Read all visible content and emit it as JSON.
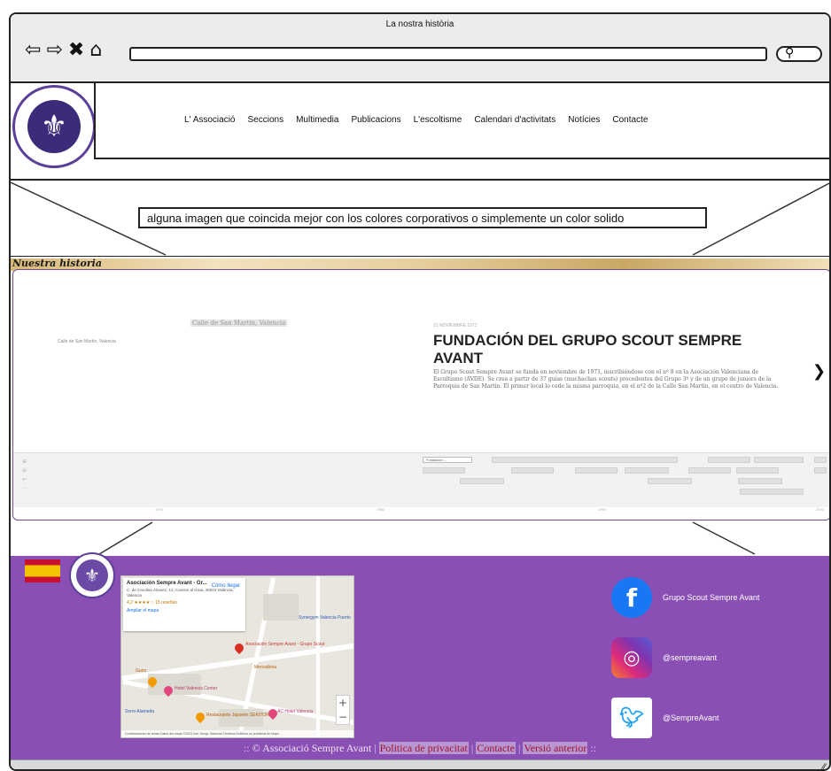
{
  "browser": {
    "title": "La nostra història",
    "nav_icons": [
      "arrow-left-icon",
      "arrow-right-icon",
      "close-icon",
      "home-icon"
    ],
    "url": "",
    "search_icon": "search-icon"
  },
  "header": {
    "logo_alt": "Grup Scout Sempre Avant logo",
    "menu": [
      "L' Associació",
      "Seccions",
      "Multimedia",
      "Publicacions",
      "L'escoltisme",
      "Calendari d'activitats",
      "Notícies",
      "Contacte"
    ]
  },
  "banner": {
    "note": "alguna imagen que coincida mejor con los colores corporativos o simplemente un color solido"
  },
  "section": {
    "title": "Nuestra historia"
  },
  "timeline": {
    "left_caption": "Calle de San Martín, Valencia",
    "media_caption": "Calle de San Martín, Valencia",
    "date": "21 NOVIEMBRE 1971",
    "title": "FUNDACIÓN DEL GRUPO SCOUT SEMPRE AVANT",
    "text": "El Grupo Scout Sempre Avant se funda en noviembre de 1971, inscribiéndose con el nº 8 en la Asociación Valenciana de Escultismo (AVDE). Se crea a partir de 37 guías (muchachas scouts) procedentes del Grupo 3º y de un grupo de juniors de la Parroquia de San Martín. El primer local lo cede la misma parroquia, en el nº2 de la Calle San Martín, en el centro de Valencia.",
    "next_icon": "chevron-right-icon",
    "zoom_labels": [
      "zoom-in-icon",
      "zoom-out-icon",
      "back-icon",
      "more-icon"
    ],
    "active_marker": "Fundación ...",
    "axis_labels": [
      "1970",
      "1980",
      "1990",
      "2000"
    ]
  },
  "footer": {
    "map": {
      "place": "Asociación Sempre Avant - Gr...",
      "address": "C. de Carolina Álvarez, 13, Camins al Grau, 46023 València, Valencia",
      "rating": "4,2 ★★★★☆  15 reseñas",
      "enlarge": "Ampliar el mapa",
      "directions": "Cómo llegar",
      "pin_label": "Asociación Sempre Avant - Grupo Scout",
      "places": [
        "Hotel Valencia Center",
        "Restaurante Japonés SEKITORI",
        "AC Hotel Valencia",
        "Sorni-Alameda",
        "Guiro",
        "Mercadona",
        "Synergym Valencia Puerto"
      ],
      "attribution": "Combinaciones de teclas   Datos del mapa ©2023 Inst. Geogr. Nacional   Términos   Notificar un problema de Maps"
    },
    "social": [
      {
        "icon": "facebook-icon",
        "label": "Grupo Scout Sempre Avant"
      },
      {
        "icon": "instagram-icon",
        "label": "@sempreavant"
      },
      {
        "icon": "twitter-icon",
        "label": "@SempreAvant"
      }
    ],
    "credit": {
      "prefix": ":: ",
      "copyright": "© Associació Sempre Avant",
      "links": [
        "Politica de privacitat",
        "Contacte",
        "Versió anterior"
      ],
      "suffix": " ::"
    }
  },
  "colors": {
    "footer_bg": "#8a4fb5",
    "accent_purple": "#5b3f9a"
  }
}
